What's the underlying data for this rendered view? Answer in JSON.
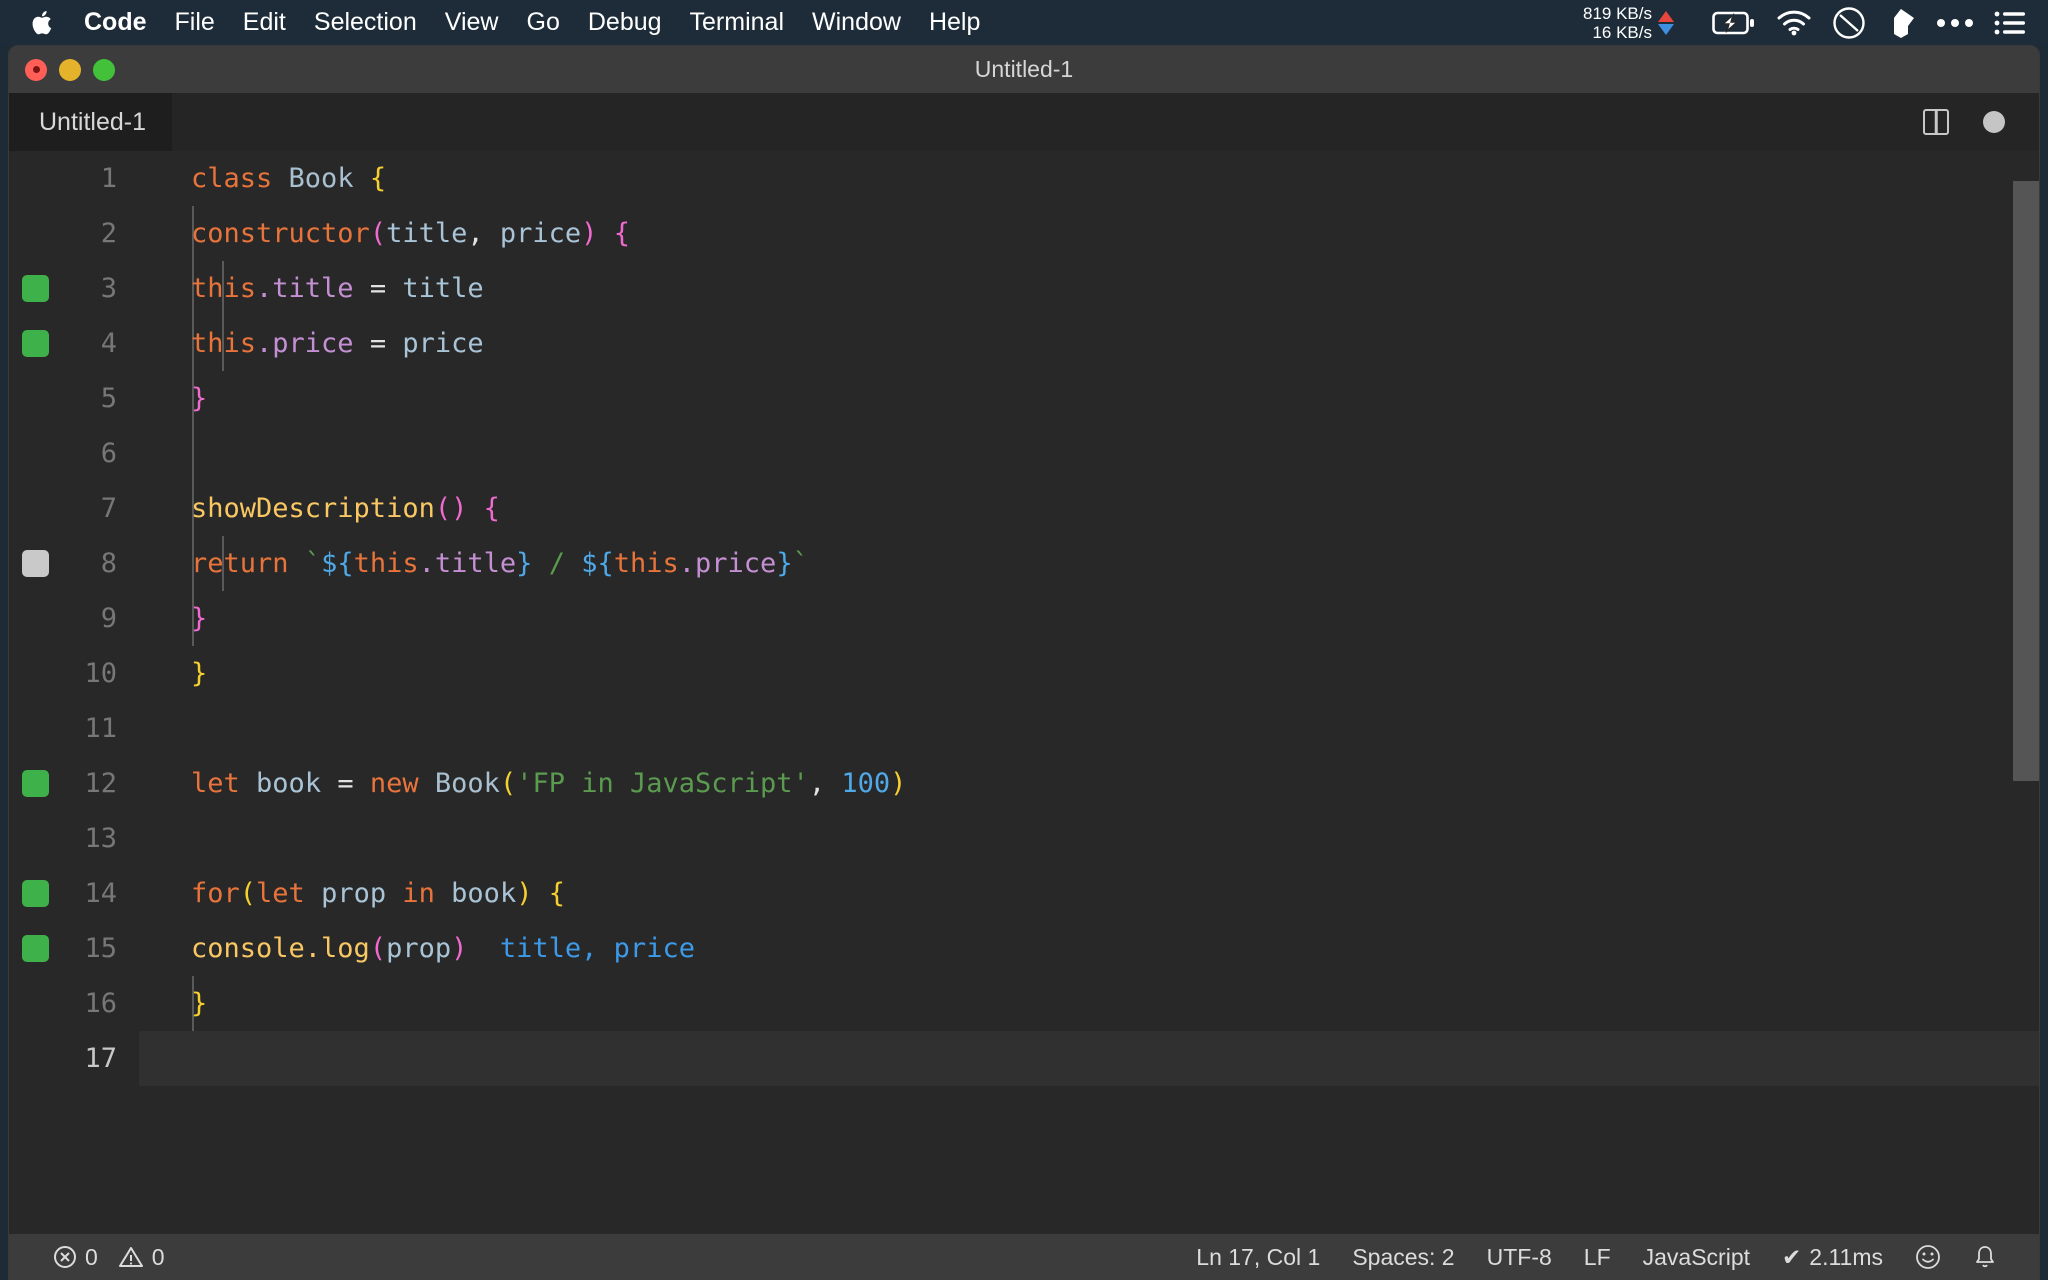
{
  "menubar": {
    "apple_icon": "apple-logo-icon",
    "items": [
      {
        "label": "Code",
        "bold": true
      },
      {
        "label": "File",
        "bold": false
      },
      {
        "label": "Edit",
        "bold": false
      },
      {
        "label": "Selection",
        "bold": false
      },
      {
        "label": "View",
        "bold": false
      },
      {
        "label": "Go",
        "bold": false
      },
      {
        "label": "Debug",
        "bold": false
      },
      {
        "label": "Terminal",
        "bold": false
      },
      {
        "label": "Window",
        "bold": false
      },
      {
        "label": "Help",
        "bold": false
      }
    ],
    "tray": {
      "upload_speed": "819 KB/s",
      "download_speed": "16 KB/s",
      "upload_color": "#e8453c",
      "download_color": "#3e8fe0",
      "icons": [
        "battery-charging-icon",
        "wifi-icon",
        "do-not-disturb-icon",
        "dropbox-icon",
        "ellipsis-icon",
        "control-center-list-icon"
      ]
    }
  },
  "window": {
    "title": "Untitled-1",
    "traffic_lights": [
      "close-button",
      "minimize-button",
      "maximize-button"
    ]
  },
  "tabbar": {
    "tabs": [
      {
        "label": "Untitled-1",
        "active": true
      }
    ],
    "actions": [
      "split-editor-icon",
      "unsaved-indicator-dot"
    ]
  },
  "editor": {
    "language": "JavaScript",
    "lines": [
      {
        "n": "1",
        "marker": null,
        "active": false
      },
      {
        "n": "2",
        "marker": null,
        "active": false
      },
      {
        "n": "3",
        "marker": "ok",
        "active": false
      },
      {
        "n": "4",
        "marker": "ok",
        "active": false
      },
      {
        "n": "5",
        "marker": null,
        "active": false
      },
      {
        "n": "6",
        "marker": null,
        "active": false
      },
      {
        "n": "7",
        "marker": null,
        "active": false
      },
      {
        "n": "8",
        "marker": "neutral",
        "active": false
      },
      {
        "n": "9",
        "marker": null,
        "active": false
      },
      {
        "n": "10",
        "marker": null,
        "active": false
      },
      {
        "n": "11",
        "marker": null,
        "active": false
      },
      {
        "n": "12",
        "marker": "ok",
        "active": false
      },
      {
        "n": "13",
        "marker": null,
        "active": false
      },
      {
        "n": "14",
        "marker": "ok",
        "active": false
      },
      {
        "n": "15",
        "marker": "ok",
        "active": false
      },
      {
        "n": "16",
        "marker": null,
        "active": false
      },
      {
        "n": "17",
        "marker": null,
        "active": true
      }
    ],
    "source": [
      "class Book {",
      "  constructor(title, price) {",
      "    this.title = title",
      "    this.price = price",
      "  }",
      "",
      "  showDescription() {",
      "    return `${this.title} / ${this.price}`",
      "  }",
      "}",
      "",
      "let book = new Book('FP in JavaScript', 100)",
      "",
      "for(let prop in book) {",
      "  console.log(prop)  title, price",
      "}",
      ""
    ],
    "inline_hint": "title, price",
    "colors": {
      "background": "#282828",
      "keyword": "#e8743b",
      "class": "#a8c0cf",
      "property": "#c58fd4",
      "function": "#fac863",
      "string": "#5b9b4f",
      "number": "#4fa9e8",
      "bracket_level1": "#f5d02f",
      "bracket_level2": "#f06ad0",
      "template_expr": "#4fa9e8",
      "inline_hint": "#3d9ae8",
      "marker_ok": "#3fb14a",
      "marker_neutral": "#c9c9c9"
    }
  },
  "statusbar": {
    "errors_icon": "error-circle-icon",
    "errors": "0",
    "warnings_icon": "warning-triangle-icon",
    "warnings": "0",
    "right_items": [
      {
        "name": "cursor-position",
        "label": "Ln 17, Col 1"
      },
      {
        "name": "indentation",
        "label": "Spaces: 2"
      },
      {
        "name": "encoding",
        "label": "UTF-8"
      },
      {
        "name": "eol-sequence",
        "label": "LF"
      },
      {
        "name": "language-mode",
        "label": "JavaScript"
      },
      {
        "name": "run-time",
        "label": "2.11ms",
        "prefix": "✔"
      }
    ],
    "feedback_icon": "smiley-icon",
    "notifications_icon": "bell-icon"
  }
}
